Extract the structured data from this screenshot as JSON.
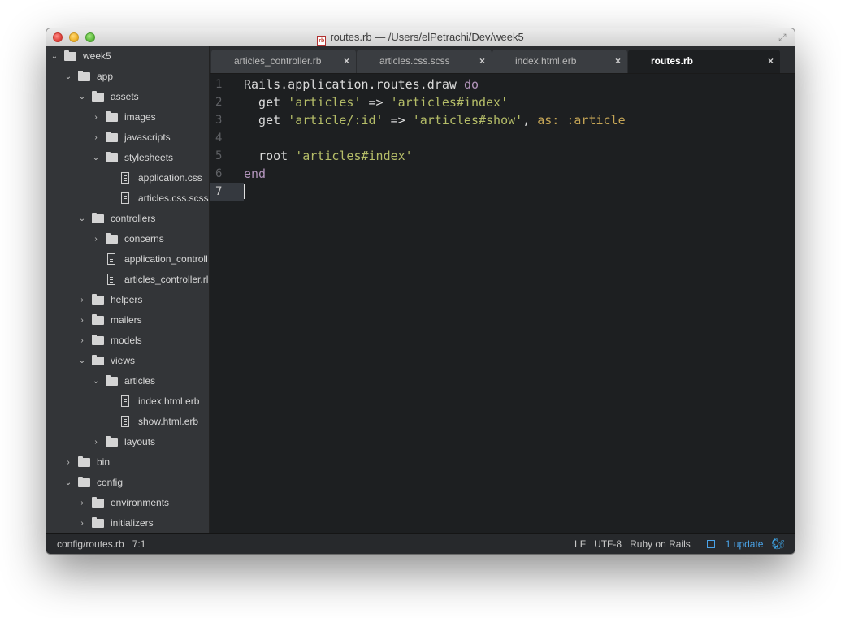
{
  "window": {
    "title": "routes.rb — /Users/elPetrachi/Dev/week5",
    "file_icon_text": "rb"
  },
  "sidebar": {
    "items": [
      {
        "label": "week5",
        "type": "folder",
        "expanded": true
      },
      {
        "label": "app",
        "type": "folder",
        "expanded": true
      },
      {
        "label": "assets",
        "type": "folder",
        "expanded": true
      },
      {
        "label": "images",
        "type": "folder",
        "expanded": false
      },
      {
        "label": "javascripts",
        "type": "folder",
        "expanded": false
      },
      {
        "label": "stylesheets",
        "type": "folder",
        "expanded": true
      },
      {
        "label": "application.css",
        "type": "file"
      },
      {
        "label": "articles.css.scss",
        "type": "file"
      },
      {
        "label": "controllers",
        "type": "folder",
        "expanded": true
      },
      {
        "label": "concerns",
        "type": "folder",
        "expanded": false
      },
      {
        "label": "application_controll",
        "type": "file"
      },
      {
        "label": "articles_controller.rl",
        "type": "file"
      },
      {
        "label": "helpers",
        "type": "folder",
        "expanded": false
      },
      {
        "label": "mailers",
        "type": "folder",
        "expanded": false
      },
      {
        "label": "models",
        "type": "folder",
        "expanded": false
      },
      {
        "label": "views",
        "type": "folder",
        "expanded": true
      },
      {
        "label": "articles",
        "type": "folder",
        "expanded": true
      },
      {
        "label": "index.html.erb",
        "type": "file"
      },
      {
        "label": "show.html.erb",
        "type": "file"
      },
      {
        "label": "layouts",
        "type": "folder",
        "expanded": false
      },
      {
        "label": "bin",
        "type": "folder",
        "expanded": false
      },
      {
        "label": "config",
        "type": "folder",
        "expanded": true
      },
      {
        "label": "environments",
        "type": "folder",
        "expanded": false
      },
      {
        "label": "initializers",
        "type": "folder",
        "expanded": false
      }
    ]
  },
  "tabs": [
    {
      "label": "articles_controller.rb",
      "active": false
    },
    {
      "label": "articles.css.scss",
      "active": false
    },
    {
      "label": "index.html.erb",
      "active": false
    },
    {
      "label": "routes.rb",
      "active": true
    }
  ],
  "editor": {
    "line_numbers": [
      "1",
      "2",
      "3",
      "4",
      "5",
      "6",
      "7"
    ],
    "current_line": "7",
    "code": {
      "l1_a": "Rails.application.routes.draw ",
      "l1_b": "do",
      "l2_a": "  get ",
      "l2_b": "'articles'",
      "l2_c": " => ",
      "l2_d": "'articles#index'",
      "l3_a": "  get ",
      "l3_b": "'article/:id'",
      "l3_c": " => ",
      "l3_d": "'articles#show'",
      "l3_e": ", ",
      "l3_f": "as:",
      "l3_g": " ",
      "l3_h": ":article",
      "l5_a": "  root ",
      "l5_b": "'articles#index'",
      "l6_a": "end"
    }
  },
  "statusbar": {
    "file_path": "config/routes.rb",
    "cursor_position": "7:1",
    "line_ending": "LF",
    "encoding": "UTF-8",
    "grammar": "Ruby on Rails",
    "updates": "1 update"
  },
  "colors": {
    "keyword": "#b294bb",
    "string": "#b5bd68",
    "symbol": "#c5a556",
    "sidebar_bg": "#333538",
    "editor_bg": "#1d1f21",
    "update_link": "#4aa3e8"
  },
  "icons": {
    "close_tab": "×",
    "expanded_chevron": "chevron-down-icon",
    "collapsed_chevron": "chevron-right-icon"
  }
}
